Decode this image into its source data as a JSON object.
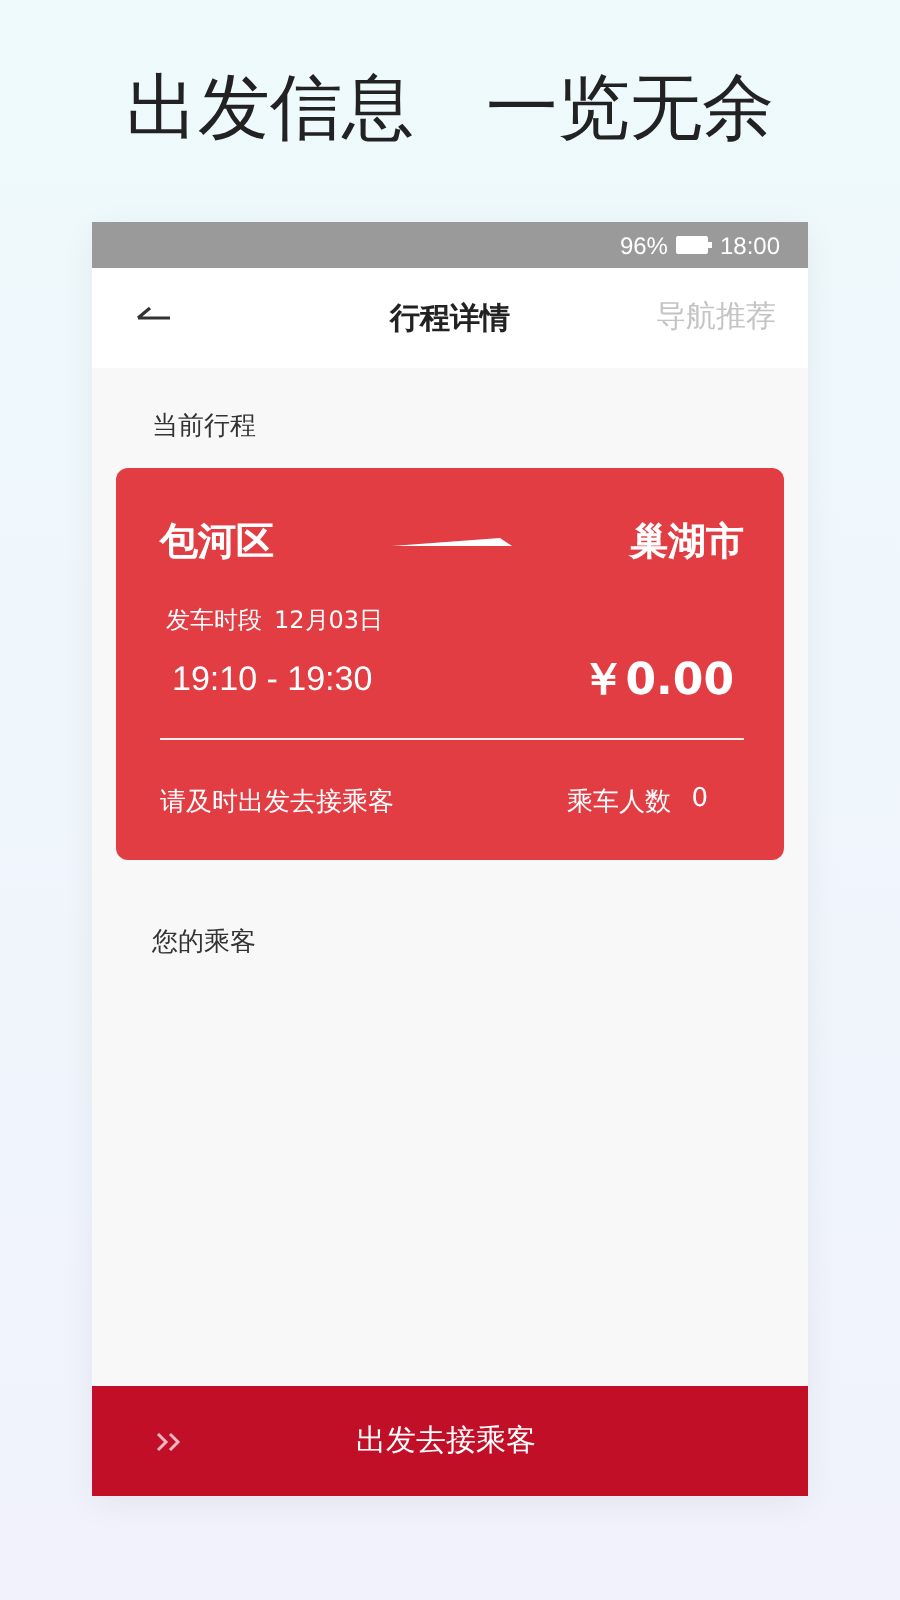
{
  "headline": {
    "left": "出发信息",
    "right": "一览无余"
  },
  "status_bar": {
    "battery": "96%",
    "time": "18:00"
  },
  "nav": {
    "title": "行程详情",
    "action": {
      "label": "导航推荐",
      "disabled": true
    }
  },
  "section_title": "当前行程",
  "trip": {
    "from": "包河区",
    "to": "巢湖市",
    "period_label": "发车时段",
    "date": "12月03日",
    "time_range": "19:10 - 19:30",
    "price": "￥0.00",
    "notice": "请及时出发去接乘客",
    "passenger_label": "乘车人数",
    "passenger_count": "0"
  },
  "passengers_title": "您的乘客",
  "bottom_button": {
    "label": "出发去接乘客"
  }
}
